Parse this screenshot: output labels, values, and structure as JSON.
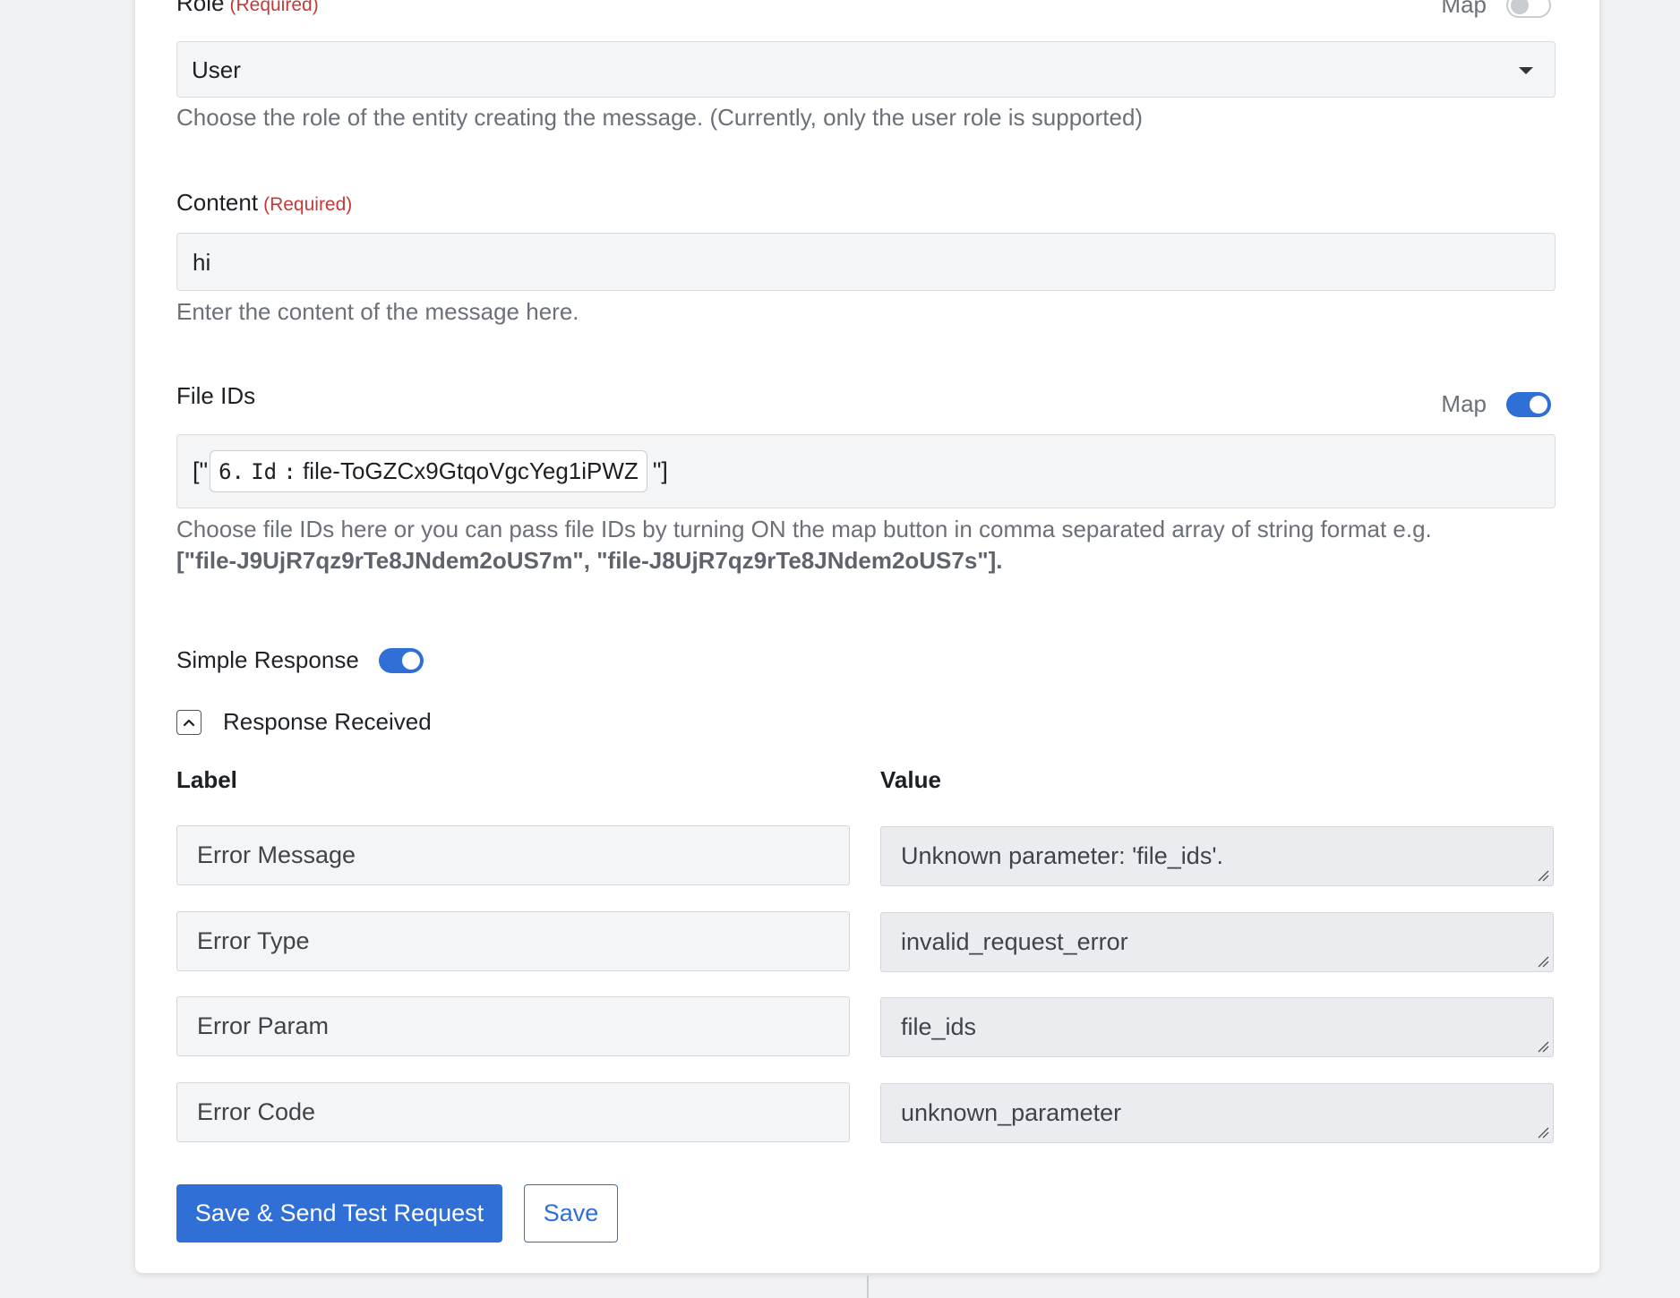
{
  "role": {
    "label": "Role",
    "required": "(Required)",
    "map_label": "Map",
    "map_on": false,
    "value": "User",
    "help": "Choose the role of the entity creating the message. (Currently, only the user role is supported)"
  },
  "content": {
    "label": "Content",
    "required": "(Required)",
    "value": "hi",
    "help": "Enter the content of the message here."
  },
  "file_ids": {
    "label": "File IDs",
    "map_label": "Map",
    "map_on": true,
    "prefix": "[\"",
    "chip_index": "6.",
    "chip_key": "Id",
    "chip_sep": ":",
    "chip_value": "file-ToGZCx9GtqoVgcYeg1iPWZ",
    "suffix": "\"]",
    "help": "Choose file IDs here or you can pass file IDs by turning ON the map button in comma separated array of string format e.g.",
    "help_example": "[\"file-J9UjR7qz9rTe8JNdem2oUS7m\", \"file-J8UjR7qz9rTe8JNdem2oUS7s\"]."
  },
  "simple_response": {
    "label": "Simple Response",
    "on": true
  },
  "response": {
    "title": "Response Received",
    "col_label": "Label",
    "col_value": "Value",
    "rows": [
      {
        "label": "Error Message",
        "value": "Unknown parameter: 'file_ids'."
      },
      {
        "label": "Error Type",
        "value": "invalid_request_error"
      },
      {
        "label": "Error Param",
        "value": "file_ids"
      },
      {
        "label": "Error Code",
        "value": "unknown_parameter"
      }
    ]
  },
  "actions": {
    "primary": "Save & Send Test Request",
    "secondary": "Save"
  },
  "colors": {
    "accent": "#2f6fd6",
    "required": "#c23a3a"
  }
}
